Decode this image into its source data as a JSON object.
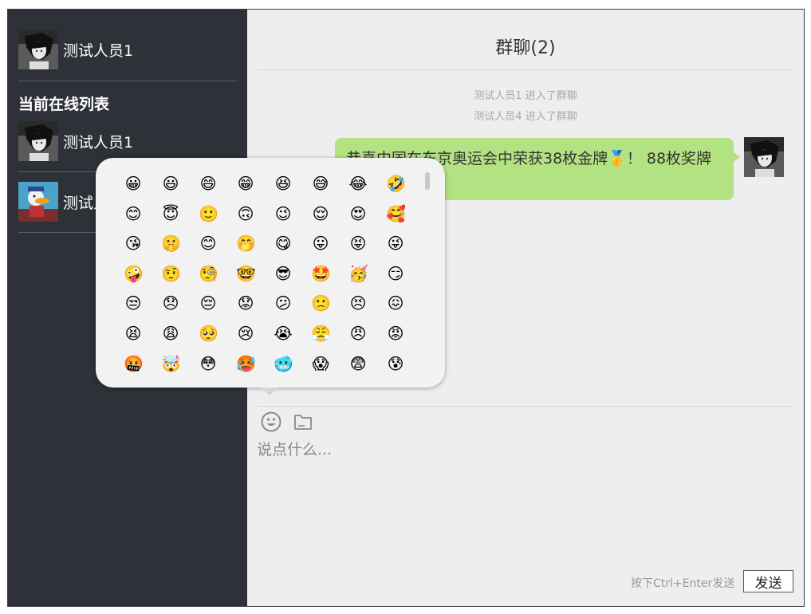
{
  "sidebar": {
    "current_user": {
      "name": "测试人员1"
    },
    "online_title": "当前在线列表",
    "online_users": [
      {
        "name": "测试人员1"
      },
      {
        "name": "测试人员4"
      }
    ]
  },
  "chat": {
    "title": "群聊(2)",
    "system_messages": [
      "测试人员1 进入了群聊",
      "测试人员4 进入了群聊"
    ],
    "message": {
      "text": "恭喜中国在东京奥运会中荣获38枚金牌🥇！ 88枚奖牌"
    }
  },
  "emoji_panel": {
    "emojis": [
      "😀",
      "😃",
      "😄",
      "😁",
      "😆",
      "😅",
      "😂",
      "🤣",
      "😊",
      "😇",
      "🙂",
      "🙃",
      "😉",
      "😌",
      "😍",
      "🥰",
      "😘",
      "🤫",
      "😊",
      "🤭",
      "😋",
      "😛",
      "😝",
      "😜",
      "🤪",
      "🤨",
      "🧐",
      "🤓",
      "😎",
      "🤩",
      "🥳",
      "😏",
      "😒",
      "😞",
      "😔",
      "😟",
      "😕",
      "🙁",
      "😣",
      "😖",
      "😫",
      "😩",
      "🥺",
      "😢",
      "😭",
      "😤",
      "😠",
      "😡",
      "🤬",
      "🤯",
      "😳",
      "🥵",
      "🥶",
      "😱",
      "😨",
      "😰"
    ]
  },
  "composer": {
    "placeholder": "说点什么...",
    "hint": "按下Ctrl+Enter发送",
    "send_label": "发送"
  },
  "icons": {
    "emoji_button": "smile-icon",
    "file_button": "folder-icon"
  },
  "colors": {
    "sidebar_bg": "#2e3138",
    "main_bg": "#eeeeee",
    "bubble_bg": "#b2e281"
  }
}
